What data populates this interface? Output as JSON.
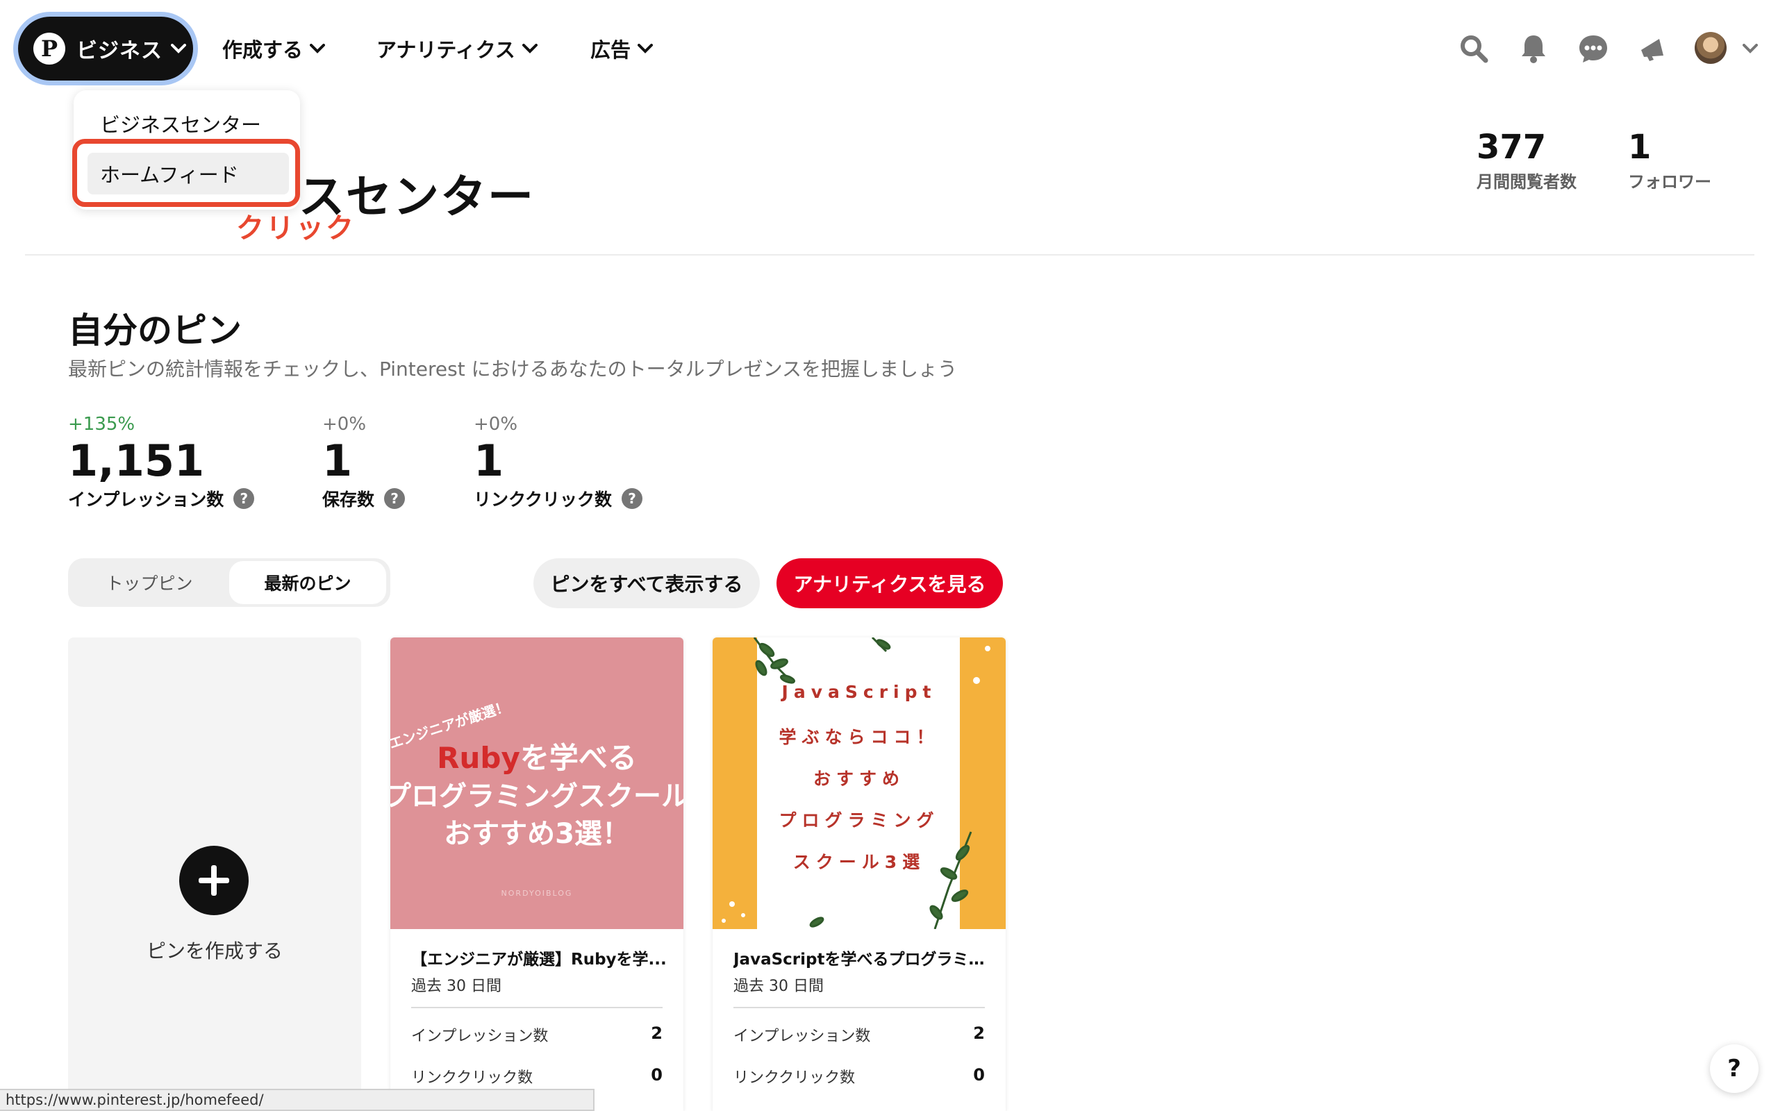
{
  "nav": {
    "business_label": "ビジネス",
    "create_label": "作成する",
    "analytics_label": "アナリティクス",
    "ads_label": "広告"
  },
  "dropdown": {
    "items": [
      "ビジネスセンター",
      "ホームフィード"
    ]
  },
  "annotation": {
    "click_label": "クリック"
  },
  "header": {
    "title": "スセンター",
    "monthly_viewers_value": "377",
    "monthly_viewers_label": "月間閲覧者数",
    "followers_value": "1",
    "followers_label": "フォロワー"
  },
  "my_pins": {
    "title": "自分のピン",
    "subtitle": "最新ピンの統計情報をチェックし、Pinterest におけるあなたのトータルプレゼンスを把握しましょう",
    "metrics": [
      {
        "delta": "+135%",
        "value": "1,151",
        "label": "インプレッション数"
      },
      {
        "delta": "+0%",
        "value": "1",
        "label": "保存数"
      },
      {
        "delta": "+0%",
        "value": "1",
        "label": "リンククリック数"
      }
    ],
    "tabs": [
      "トップピン",
      "最新のピン"
    ],
    "show_all_button": "ピンをすべて表示する",
    "analytics_button": "アナリティクスを見る",
    "create_pin_label": "ピンを作成する"
  },
  "pins": [
    {
      "title": "【エンジニアが厳選】Rubyを学...",
      "period": "過去 30 日間",
      "impressions_label": "インプレッション数",
      "impressions": "2",
      "clicks_label": "リンククリック数",
      "clicks": "0",
      "image_text": {
        "tag": "エンジニアが厳選！",
        "line1_red": "Ruby",
        "line1_rest": "を学べる",
        "line2": "プログラミングスクール",
        "line3": "おすすめ3選！",
        "footer": "NORDYOIBLOG"
      }
    },
    {
      "title": "JavaScriptを学べるプログラミン...",
      "period": "過去 30 日間",
      "impressions_label": "インプレッション数",
      "impressions": "2",
      "clicks_label": "リンククリック数",
      "clicks": "0",
      "image_text": {
        "line1": "JavaScript",
        "line2": "学ぶならココ！",
        "line3": "おすすめ",
        "line4": "プログラミング",
        "line5": "スクール3選"
      }
    }
  ],
  "status_bar": {
    "url": "https://www.pinterest.jp/homefeed/"
  },
  "help": {
    "label": "?"
  },
  "colors": {
    "brand_red": "#e60023",
    "annotation_red": "#e8472f",
    "positive_green": "#3a9a4e",
    "focus_ring": "#a9c7f4"
  },
  "icons": [
    "pinterest-logo",
    "chevron-down-icon",
    "search-icon",
    "bell-icon",
    "chat-icon",
    "megaphone-icon",
    "avatar",
    "question-icon",
    "plus-icon"
  ]
}
